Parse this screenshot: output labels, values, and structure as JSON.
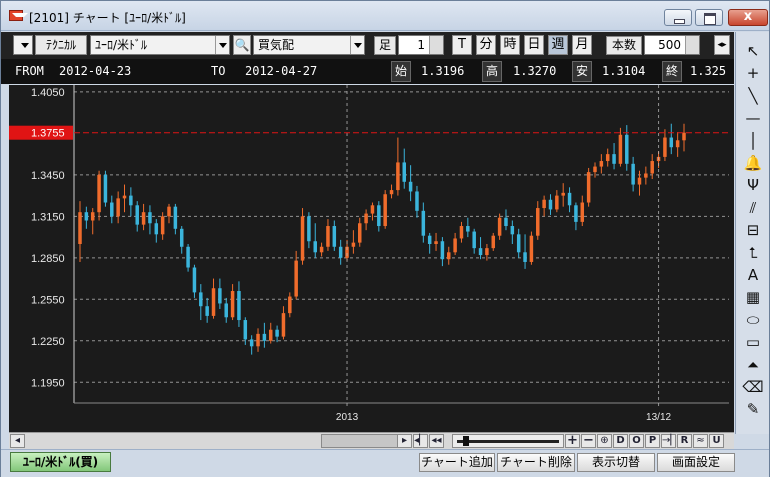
{
  "window": {
    "title": "[2101] チャート [ﾕｰﾛ/米ﾄﾞﾙ]",
    "close_label": "x"
  },
  "toolbar": {
    "technical_label": "ﾃｸﾆｶﾙ",
    "symbol_value": "ﾕｰﾛ/米ﾄﾞﾙ",
    "price_type_value": "買気配",
    "bar_unit_label": "足",
    "bar_unit_value": "1",
    "interval_buttons": [
      "T",
      "分",
      "時",
      "日",
      "週",
      "月"
    ],
    "active_interval": "週",
    "count_label": "本数",
    "count_value": "500"
  },
  "info": {
    "from_label": "FROM",
    "from_date": "2012-04-23",
    "to_label": "TO",
    "to_date": "2012-04-27",
    "open_label": "始",
    "open": "1.3196",
    "high_label": "高",
    "high": "1.3270",
    "low_label": "安",
    "low": "1.3104",
    "close_label": "終",
    "close": "1.325"
  },
  "colors": {
    "up": "#f06c2c",
    "down": "#3bb5dc",
    "current_line": "#e01414",
    "background": "#1b1b1b",
    "grid": "#bbbbbb"
  },
  "chart_data": {
    "type": "candlestick",
    "ylim": [
      1.18,
      1.41
    ],
    "y_ticks": [
      "1.4050",
      "1.3450",
      "1.3150",
      "1.2850",
      "1.2550",
      "1.2250",
      "1.1950"
    ],
    "current_price": "1.3755",
    "x_labels": [
      "2013",
      "13/12"
    ],
    "ohlc": [
      [
        1.295,
        1.326,
        1.282,
        1.318
      ],
      [
        1.318,
        1.322,
        1.306,
        1.312
      ],
      [
        1.312,
        1.321,
        1.302,
        1.318
      ],
      [
        1.318,
        1.348,
        1.312,
        1.345
      ],
      [
        1.345,
        1.348,
        1.322,
        1.325
      ],
      [
        1.325,
        1.33,
        1.31,
        1.315
      ],
      [
        1.315,
        1.333,
        1.31,
        1.328
      ],
      [
        1.328,
        1.338,
        1.318,
        1.33
      ],
      [
        1.33,
        1.336,
        1.315,
        1.323
      ],
      [
        1.323,
        1.326,
        1.304,
        1.309
      ],
      [
        1.309,
        1.324,
        1.305,
        1.318
      ],
      [
        1.318,
        1.323,
        1.302,
        1.31
      ],
      [
        1.31,
        1.313,
        1.296,
        1.302
      ],
      [
        1.302,
        1.318,
        1.298,
        1.315
      ],
      [
        1.315,
        1.324,
        1.31,
        1.322
      ],
      [
        1.322,
        1.324,
        1.302,
        1.306
      ],
      [
        1.306,
        1.308,
        1.288,
        1.293
      ],
      [
        1.293,
        1.295,
        1.275,
        1.278
      ],
      [
        1.278,
        1.28,
        1.256,
        1.26
      ],
      [
        1.26,
        1.266,
        1.24,
        1.25
      ],
      [
        1.25,
        1.256,
        1.238,
        1.243
      ],
      [
        1.243,
        1.27,
        1.241,
        1.263
      ],
      [
        1.263,
        1.27,
        1.248,
        1.252
      ],
      [
        1.252,
        1.256,
        1.238,
        1.242
      ],
      [
        1.242,
        1.266,
        1.24,
        1.261
      ],
      [
        1.261,
        1.268,
        1.235,
        1.24
      ],
      [
        1.24,
        1.242,
        1.222,
        1.226
      ],
      [
        1.226,
        1.229,
        1.215,
        1.221
      ],
      [
        1.221,
        1.234,
        1.217,
        1.23
      ],
      [
        1.23,
        1.238,
        1.22,
        1.225
      ],
      [
        1.225,
        1.238,
        1.223,
        1.233
      ],
      [
        1.233,
        1.236,
        1.224,
        1.228
      ],
      [
        1.228,
        1.25,
        1.226,
        1.245
      ],
      [
        1.245,
        1.26,
        1.242,
        1.257
      ],
      [
        1.257,
        1.29,
        1.255,
        1.283
      ],
      [
        1.283,
        1.321,
        1.28,
        1.315
      ],
      [
        1.315,
        1.318,
        1.292,
        1.297
      ],
      [
        1.297,
        1.31,
        1.285,
        1.289
      ],
      [
        1.289,
        1.296,
        1.286,
        1.293
      ],
      [
        1.293,
        1.313,
        1.29,
        1.308
      ],
      [
        1.308,
        1.312,
        1.29,
        1.293
      ],
      [
        1.293,
        1.298,
        1.28,
        1.285
      ],
      [
        1.285,
        1.298,
        1.283,
        1.293
      ],
      [
        1.293,
        1.305,
        1.288,
        1.296
      ],
      [
        1.296,
        1.314,
        1.293,
        1.31
      ],
      [
        1.31,
        1.32,
        1.305,
        1.317
      ],
      [
        1.317,
        1.325,
        1.312,
        1.323
      ],
      [
        1.323,
        1.326,
        1.304,
        1.308
      ],
      [
        1.308,
        1.334,
        1.306,
        1.331
      ],
      [
        1.331,
        1.338,
        1.328,
        1.334
      ],
      [
        1.334,
        1.372,
        1.33,
        1.354
      ],
      [
        1.354,
        1.364,
        1.335,
        1.34
      ],
      [
        1.34,
        1.352,
        1.326,
        1.333
      ],
      [
        1.333,
        1.337,
        1.314,
        1.319
      ],
      [
        1.319,
        1.325,
        1.296,
        1.301
      ],
      [
        1.301,
        1.303,
        1.288,
        1.295
      ],
      [
        1.295,
        1.303,
        1.29,
        1.297
      ],
      [
        1.297,
        1.3,
        1.279,
        1.284
      ],
      [
        1.284,
        1.293,
        1.28,
        1.289
      ],
      [
        1.289,
        1.303,
        1.287,
        1.299
      ],
      [
        1.299,
        1.311,
        1.296,
        1.308
      ],
      [
        1.308,
        1.314,
        1.3,
        1.304
      ],
      [
        1.304,
        1.306,
        1.288,
        1.292
      ],
      [
        1.292,
        1.3,
        1.284,
        1.287
      ],
      [
        1.287,
        1.295,
        1.283,
        1.292
      ],
      [
        1.292,
        1.303,
        1.29,
        1.301
      ],
      [
        1.301,
        1.317,
        1.298,
        1.314
      ],
      [
        1.314,
        1.32,
        1.305,
        1.308
      ],
      [
        1.308,
        1.312,
        1.295,
        1.302
      ],
      [
        1.302,
        1.306,
        1.285,
        1.289
      ],
      [
        1.289,
        1.302,
        1.277,
        1.282
      ],
      [
        1.282,
        1.304,
        1.28,
        1.301
      ],
      [
        1.301,
        1.326,
        1.298,
        1.321
      ],
      [
        1.321,
        1.33,
        1.315,
        1.327
      ],
      [
        1.327,
        1.331,
        1.316,
        1.32
      ],
      [
        1.32,
        1.334,
        1.318,
        1.33
      ],
      [
        1.33,
        1.339,
        1.322,
        1.332
      ],
      [
        1.332,
        1.336,
        1.318,
        1.323
      ],
      [
        1.323,
        1.325,
        1.305,
        1.311
      ],
      [
        1.311,
        1.33,
        1.308,
        1.325
      ],
      [
        1.325,
        1.35,
        1.322,
        1.347
      ],
      [
        1.347,
        1.354,
        1.343,
        1.351
      ],
      [
        1.351,
        1.36,
        1.346,
        1.355
      ],
      [
        1.355,
        1.364,
        1.351,
        1.36
      ],
      [
        1.36,
        1.368,
        1.349,
        1.353
      ],
      [
        1.353,
        1.379,
        1.351,
        1.374
      ],
      [
        1.374,
        1.381,
        1.348,
        1.353
      ],
      [
        1.353,
        1.358,
        1.333,
        1.338
      ],
      [
        1.338,
        1.348,
        1.33,
        1.343
      ],
      [
        1.343,
        1.351,
        1.338,
        1.346
      ],
      [
        1.346,
        1.36,
        1.342,
        1.355
      ],
      [
        1.355,
        1.362,
        1.35,
        1.358
      ],
      [
        1.358,
        1.378,
        1.355,
        1.372
      ],
      [
        1.372,
        1.382,
        1.36,
        1.365
      ],
      [
        1.365,
        1.376,
        1.358,
        1.37
      ],
      [
        1.37,
        1.382,
        1.362,
        1.3755
      ]
    ]
  },
  "scrollbar": {
    "left_arrow": "◂",
    "right_arrow": "▸",
    "first_label": "◂▏",
    "prev_label": "◂◂",
    "next_label": "▸▸",
    "zoom_in_label": "+",
    "zoom_out_label": "−",
    "zoom_fit_label": "⊕",
    "d_label": "D",
    "o_label": "O",
    "p_label": "P",
    "end_label": "→▏",
    "r_label": "R",
    "chart_label": "≈",
    "u_label": "U"
  },
  "palette_icons": [
    {
      "name": "cursor-arrow-icon",
      "glyph": "↖"
    },
    {
      "name": "crosshair-icon",
      "glyph": "+"
    },
    {
      "name": "trendline-icon",
      "glyph": "╲"
    },
    {
      "name": "horizontal-line-icon",
      "glyph": "—"
    },
    {
      "name": "vertical-line-icon",
      "glyph": "│"
    },
    {
      "name": "alert-bell-icon",
      "glyph": "🔔"
    },
    {
      "name": "pitchfork-icon",
      "glyph": "Ψ"
    },
    {
      "name": "fibonacci-icon",
      "glyph": "⫽"
    },
    {
      "name": "regression-icon",
      "glyph": "⊟"
    },
    {
      "name": "price-label-icon",
      "glyph": "⮤"
    },
    {
      "name": "text-icon",
      "glyph": "A"
    },
    {
      "name": "table-icon",
      "glyph": "▦"
    },
    {
      "name": "ellipse-icon",
      "glyph": "⬭"
    },
    {
      "name": "rectangle-icon",
      "glyph": "▭"
    },
    {
      "name": "triangle-icon",
      "glyph": "⏶"
    },
    {
      "name": "eraser-icon",
      "glyph": "⌫"
    },
    {
      "name": "edit-icon",
      "glyph": "✎"
    }
  ],
  "bottom": {
    "sheet_tab": "ﾕｰﾛ/米ﾄﾞﾙ(買)",
    "buttons": [
      "チャート追加",
      "チャート削除",
      "表示切替",
      "画面設定"
    ]
  }
}
